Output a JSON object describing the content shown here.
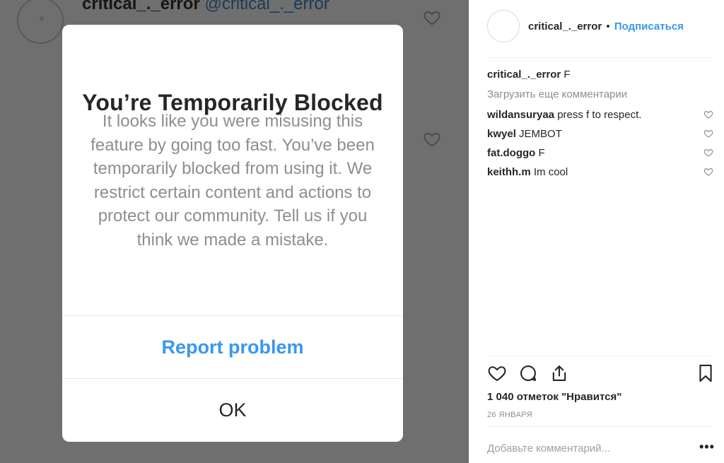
{
  "background_post": {
    "username": "critical_._error",
    "handle": "@critical_._error"
  },
  "modal": {
    "title": "You’re Temporarily Blocked",
    "body": "It looks like you were misusing this feature by going too fast. You’ve been temporarily blocked from using it. We restrict certain content and actions to protect our community. Tell us if you think we made a mistake.",
    "report_label": "Report problem",
    "ok_label": "OK"
  },
  "post": {
    "username": "critical_._error",
    "dot": "•",
    "follow_label": "Подписаться",
    "caption": {
      "user": "critical_._error",
      "text": "F"
    },
    "load_more_label": "Загрузить еще комментарии",
    "comments": [
      {
        "user": "wildansuryaa",
        "text": "press f to respect."
      },
      {
        "user": "kwyel",
        "text": "JEMBOT"
      },
      {
        "user": "fat.doggo",
        "text": "F"
      },
      {
        "user": "keithh.m",
        "text": "Im cool"
      }
    ],
    "likes_text": "1 040 отметок \"Нравится\"",
    "date_text": "26 ЯНВАРЯ",
    "add_comment_placeholder": "Добавьте комментарий...",
    "more_label": "•••"
  },
  "icons": [
    "heart-icon",
    "comment-icon",
    "share-icon",
    "bookmark-icon"
  ],
  "colors": {
    "accent": "#3897f0",
    "overlay": "#6f6f6f",
    "text": "#262626",
    "muted": "#8e8e8e"
  }
}
